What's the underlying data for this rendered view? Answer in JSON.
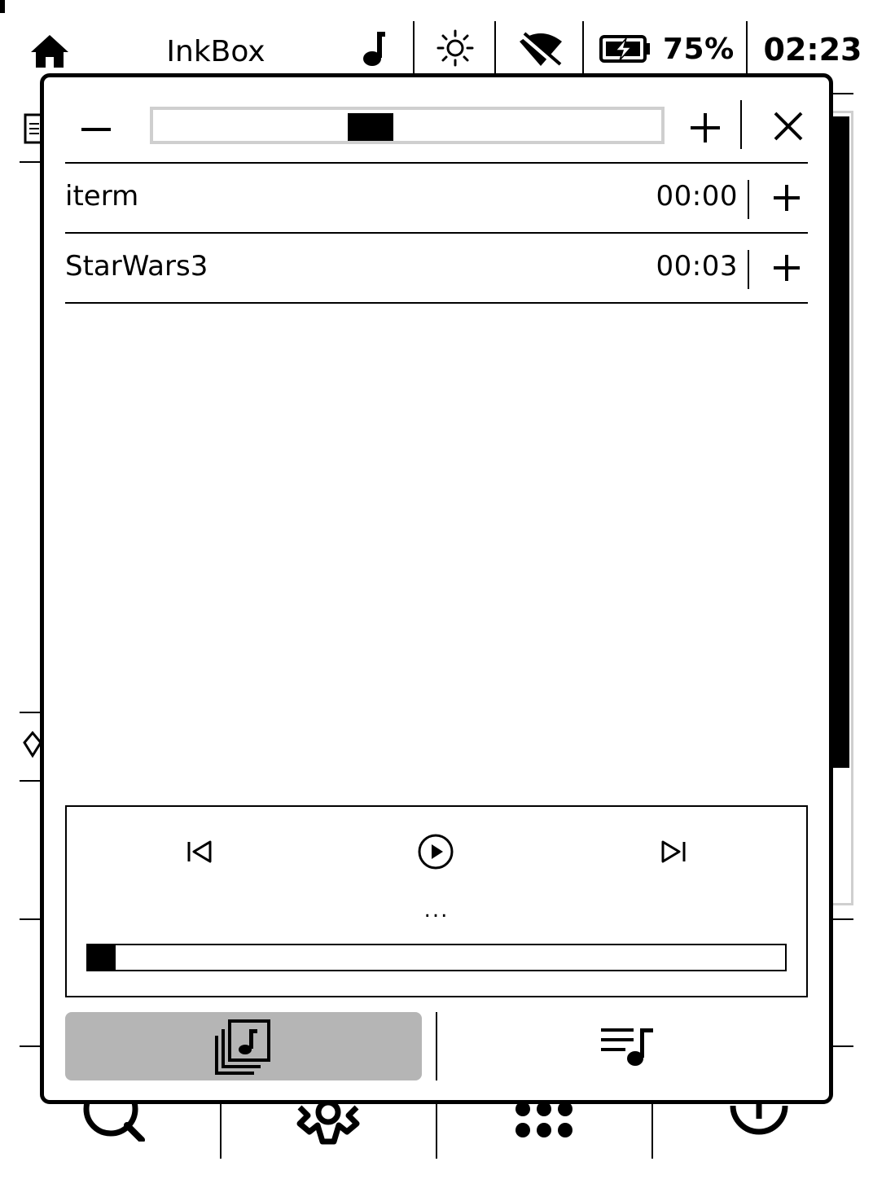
{
  "statusbar": {
    "title": "InkBox",
    "battery_percent": "75%",
    "time": "02:23",
    "icons": [
      "home-icon",
      "music-note-icon",
      "brightness-icon",
      "wifi-off-icon",
      "battery-charging-icon"
    ]
  },
  "dialog": {
    "volume": {
      "level": 0.42
    },
    "tracks": [
      {
        "name": "iterm",
        "duration": "00:00"
      },
      {
        "name": "StarWars3",
        "duration": "00:03"
      }
    ],
    "player": {
      "now_playing": "...",
      "progress": 0.04
    },
    "tabs": [
      {
        "id": "library",
        "icon": "music-library-icon",
        "active": true
      },
      {
        "id": "playlist",
        "icon": "playlist-icon",
        "active": false
      }
    ]
  }
}
